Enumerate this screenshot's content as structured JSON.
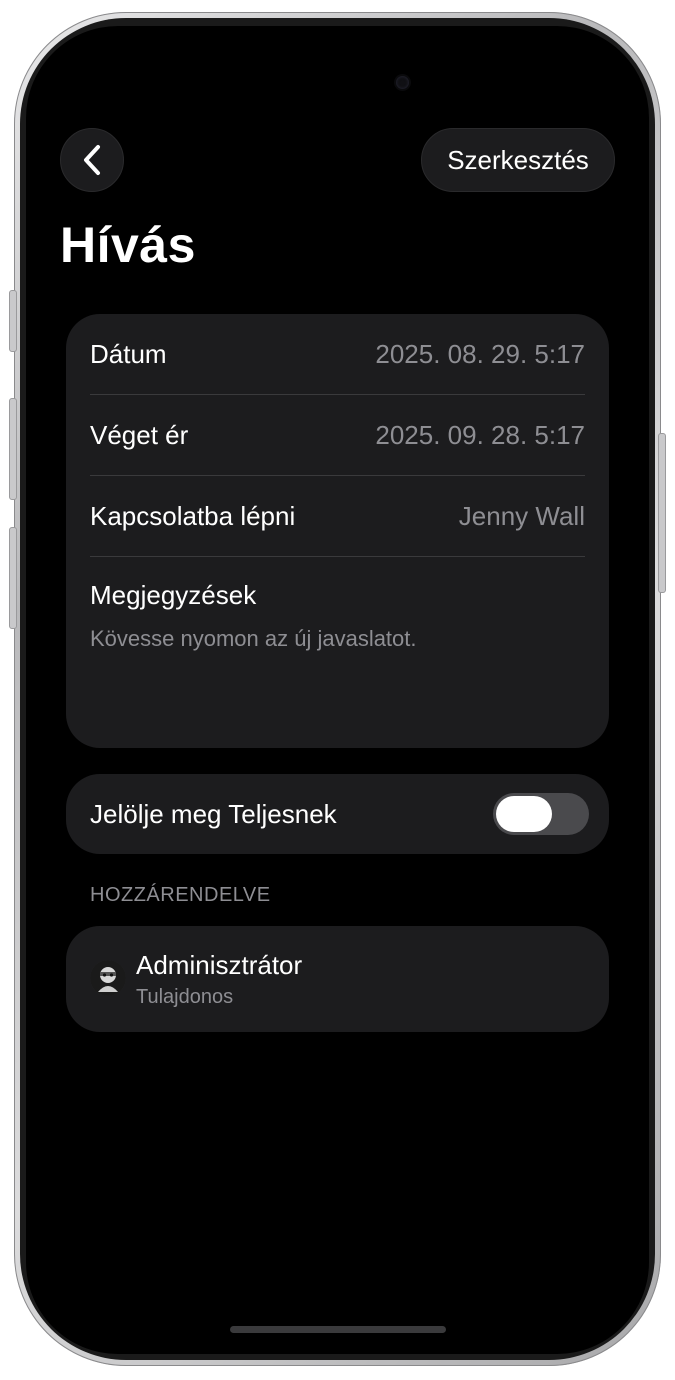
{
  "header": {
    "back_icon": "chevron-left-icon",
    "edit_label": "Szerkesztés",
    "title": "Hívás"
  },
  "details": {
    "rows": [
      {
        "label": "Dátum",
        "value": "2025. 08. 29. 5:17"
      },
      {
        "label": "Véget ér",
        "value": "2025. 09. 28. 5:17"
      },
      {
        "label": "Kapcsolatba lépni",
        "value": "Jenny Wall"
      }
    ],
    "notes_label": "Megjegyzések",
    "notes_text": "Kövesse nyomon az új javaslatot."
  },
  "complete_toggle": {
    "label": "Jelölje meg Teljesnek",
    "on": false
  },
  "assigned": {
    "section_label": "HOZZÁRENDELVE",
    "name": "Adminisztrátor",
    "role": "Tulajdonos"
  },
  "colors": {
    "background": "#000000",
    "card": "#1c1c1e",
    "primary_text": "#ffffff",
    "secondary_text": "#8e8e93",
    "divider": "#3a3a3c"
  }
}
